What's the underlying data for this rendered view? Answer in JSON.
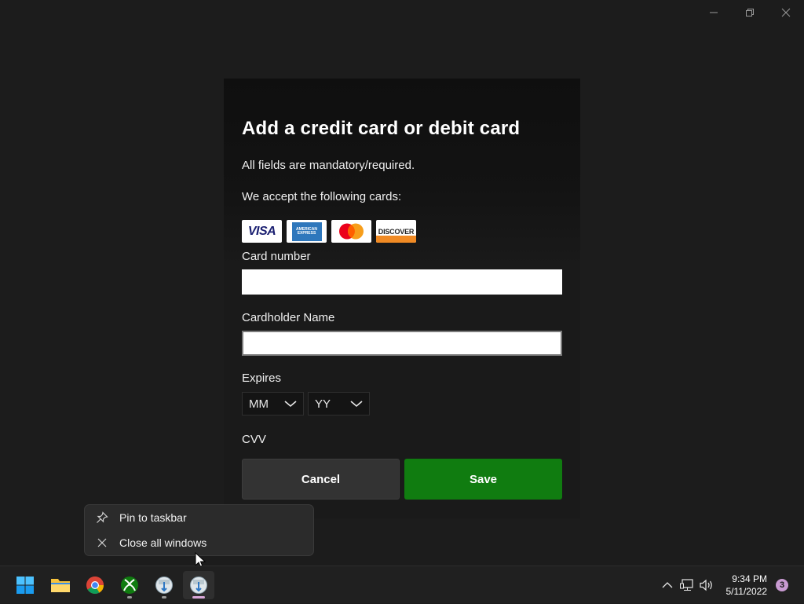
{
  "dialog": {
    "title": "Add a credit card or debit card",
    "mandatory_note": "All fields are mandatory/required.",
    "accept_note": "We accept the following cards:",
    "cards": [
      {
        "name": "visa-card-logo",
        "text": "VISA"
      },
      {
        "name": "amex-card-logo",
        "text": "AMERICAN EXPRESS"
      },
      {
        "name": "mastercard-card-logo",
        "text": ""
      },
      {
        "name": "discover-card-logo",
        "text": "DISCOVER"
      }
    ],
    "card_number_label": "Card number",
    "card_number_value": "",
    "cardholder_label": "Cardholder Name",
    "cardholder_value": "",
    "expires_label": "Expires",
    "month_select": "MM",
    "year_select": "YY",
    "cvv_label": "CVV",
    "cancel_label": "Cancel",
    "save_label": "Save"
  },
  "context_menu": {
    "items": [
      {
        "label": "Pin to taskbar",
        "icon": "pin-icon"
      },
      {
        "label": "Close all windows",
        "icon": "close-icon"
      }
    ]
  },
  "taskbar": {
    "apps": [
      "start-icon",
      "file-explorer-icon",
      "chrome-icon",
      "xbox-icon",
      "app-icon",
      "app-icon-active"
    ],
    "time": "9:34 PM",
    "date": "5/11/2022",
    "notification_count": "3"
  },
  "colors": {
    "save_button": "#107c10",
    "cancel_button": "#333333",
    "background": "#1c1c1c"
  }
}
